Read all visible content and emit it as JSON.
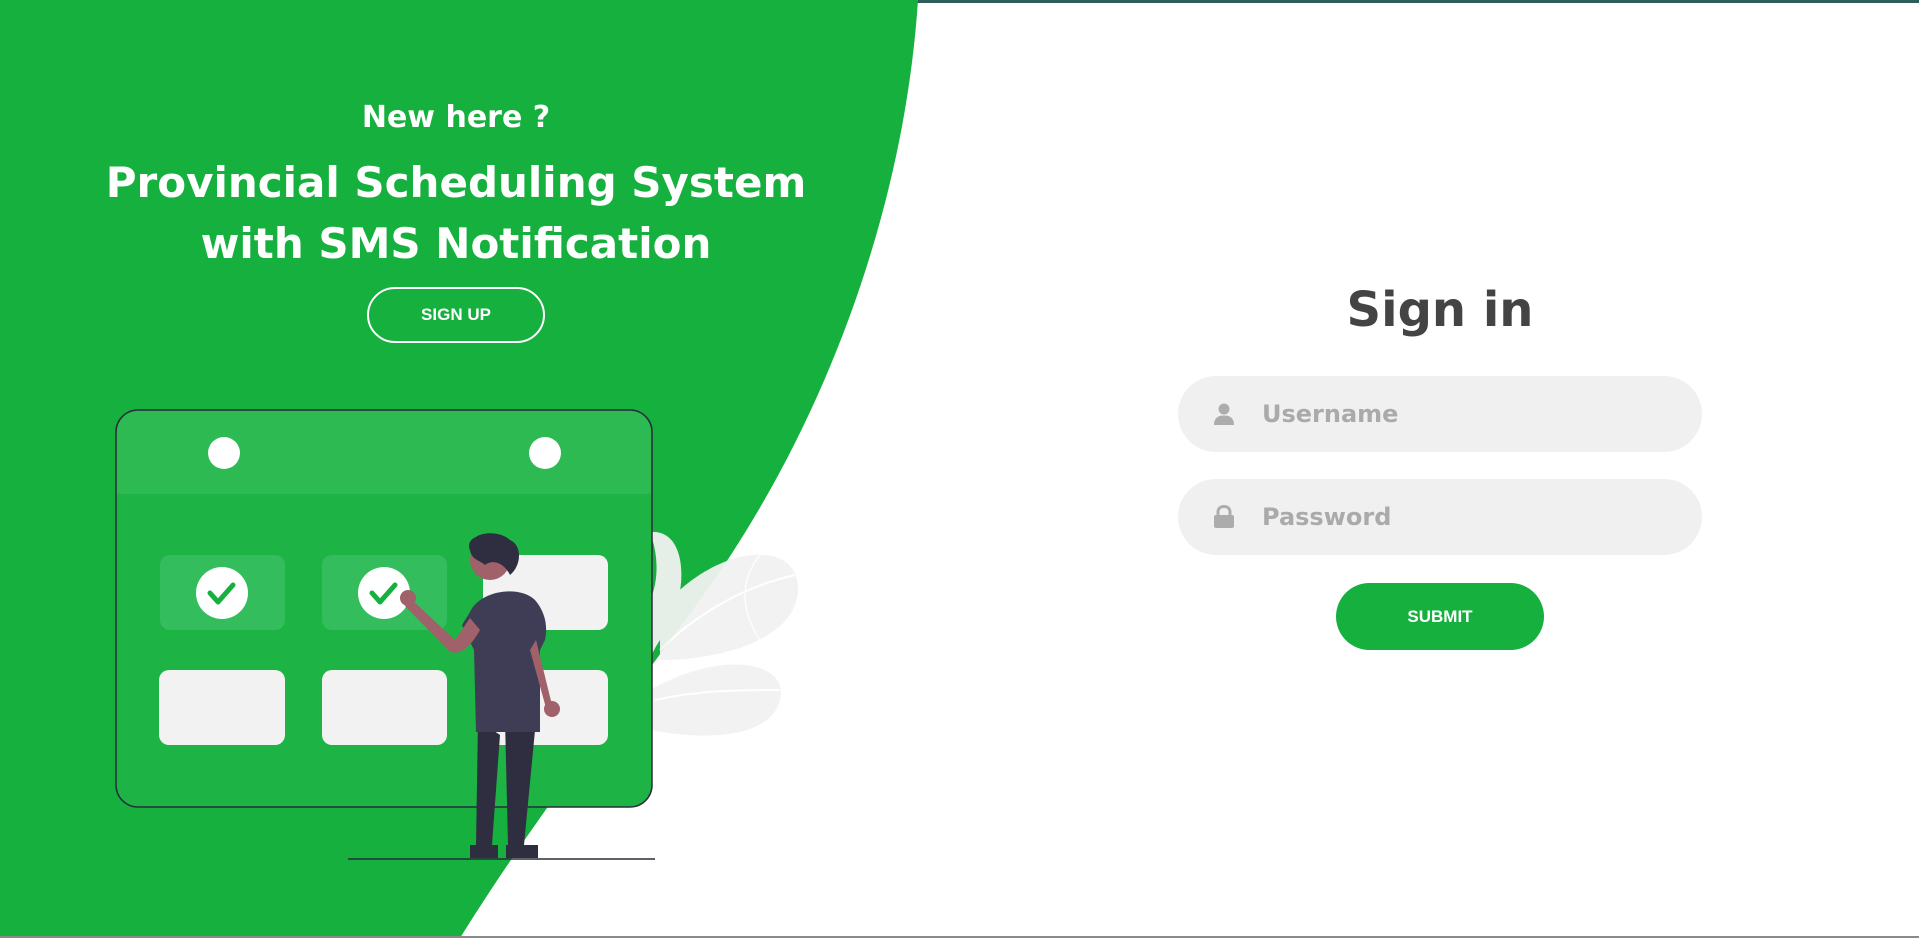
{
  "colors": {
    "brand_green": "#16b03e",
    "text_dark": "#444444",
    "input_bg": "#f0f0f0",
    "placeholder": "#aaaaaa",
    "white": "#ffffff"
  },
  "left_panel": {
    "heading": "New here ?",
    "title": "Provincial Scheduling System with SMS Notification",
    "signup_label": "SIGN UP"
  },
  "signin": {
    "title": "Sign in",
    "username": {
      "placeholder": "Username",
      "value": "",
      "icon": "user-icon"
    },
    "password": {
      "placeholder": "Password",
      "value": "",
      "icon": "lock-icon"
    },
    "submit_label": "SUBMIT"
  }
}
